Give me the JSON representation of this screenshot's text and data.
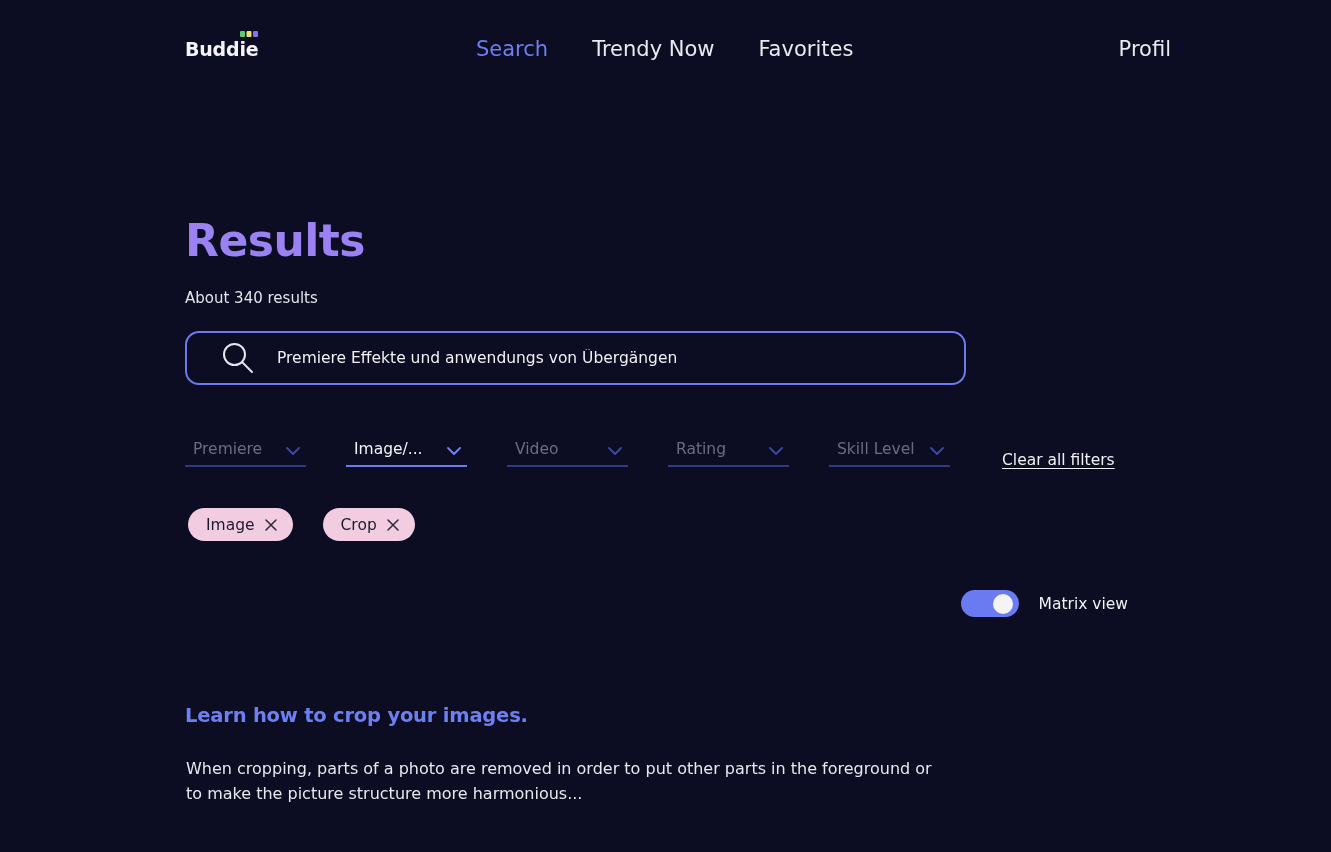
{
  "logo": {
    "text": "Buddie"
  },
  "nav": [
    {
      "label": "Search",
      "selected": true
    },
    {
      "label": "Trendy Now",
      "selected": false
    },
    {
      "label": "Favorites",
      "selected": false
    }
  ],
  "profile_link": "Profil",
  "heading": "Results",
  "result_count": "About 340 results",
  "search": {
    "value": "Premiere Effekte und anwendungs von Übergängen"
  },
  "filters": [
    {
      "label": "Premiere",
      "active": false
    },
    {
      "label": "Image/...",
      "active": true
    },
    {
      "label": "Video",
      "active": false
    },
    {
      "label": "Rating",
      "active": false
    },
    {
      "label": "Skill Level",
      "active": false
    }
  ],
  "clear_filters": "Clear all filters",
  "chips": [
    {
      "label": "Image"
    },
    {
      "label": "Crop"
    }
  ],
  "matrix_view": {
    "label": "Matrix view",
    "on": true
  },
  "results": [
    {
      "title": "Learn how to crop your images.",
      "description": "When cropping, parts of a photo are removed in order to put other parts in the foreground or to make the picture structure more harmonious..."
    }
  ]
}
